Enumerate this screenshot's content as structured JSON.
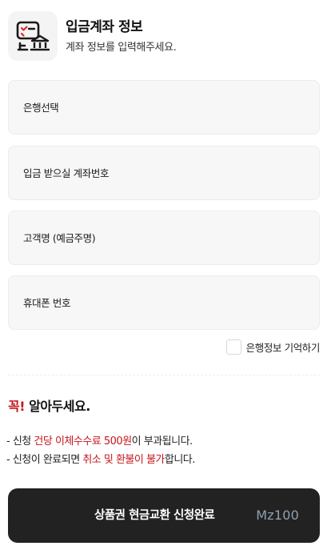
{
  "header": {
    "icon": "bank-account-icon",
    "title": "입금계좌 정보",
    "subtitle": "계좌 정보를 입력해주세요."
  },
  "form": {
    "bank_select_placeholder": "은행선택",
    "account_number_placeholder": "입금 받으실 계좌번호",
    "holder_name_placeholder": "고객명 (예금주명)",
    "phone_placeholder": "휴대폰 번호",
    "remember_label": "은행정보 기억하기",
    "remember_checked": false
  },
  "notice": {
    "title_accent": "꼭!",
    "title_rest": " 알아두세요.",
    "line1_prefix": "- 신청 ",
    "line1_highlight": "건당 이체수수료 500원",
    "line1_suffix": "이 부과됩니다.",
    "line2_prefix": "- 신청이 완료되면 ",
    "line2_highlight": "취소 및 환불이 불가",
    "line2_suffix": "합니다."
  },
  "submit": {
    "label": "상품권 현금교환 신청완료",
    "amount": "Mz100"
  },
  "colors": {
    "accent_red": "#c4161c",
    "button_bg": "#222222",
    "amount_text": "#8fa0b3"
  }
}
